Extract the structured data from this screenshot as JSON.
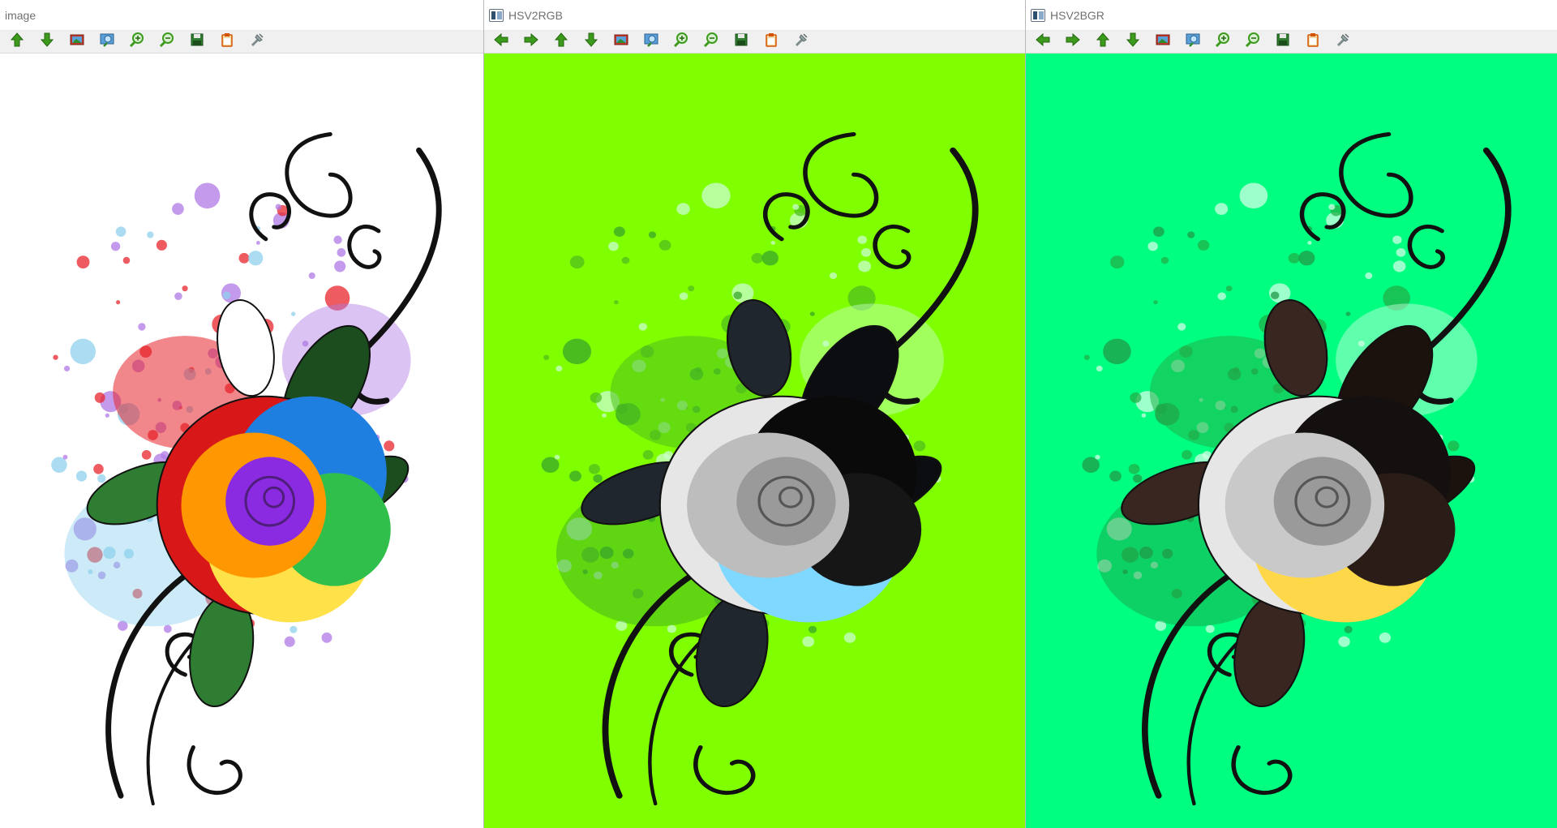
{
  "windows": [
    {
      "title": "image",
      "show_app_icon": false,
      "background": "#ffffff",
      "toolbar": [
        "arrow-up-icon",
        "arrow-down-icon",
        "image-icon",
        "zoom-region-icon",
        "zoom-in-icon",
        "zoom-out-icon",
        "save-icon",
        "copy-clipboard-icon",
        "properties-icon"
      ],
      "palette": {
        "splash1": "#e8242c",
        "splash2": "#b07ae6",
        "splash3": "#8fd0ee",
        "petal_outer": "#d81818",
        "petal2": "#ff9800",
        "petal3": "#ffe14a",
        "petal4": "#1e7fe0",
        "petal5": "#2fbf4a",
        "petal_center": "#8a2be2",
        "leaf": "#2e7d32",
        "leaf_dark": "#1b4d1f",
        "vine": "#111111"
      }
    },
    {
      "title": "HSV2RGB",
      "show_app_icon": true,
      "background": "#80ff00",
      "toolbar": [
        "arrow-left-icon",
        "arrow-right-icon",
        "arrow-up-icon",
        "arrow-down-icon",
        "image-icon",
        "zoom-region-icon",
        "zoom-in-icon",
        "zoom-out-icon",
        "save-icon",
        "copy-clipboard-icon",
        "properties-icon"
      ],
      "palette": {
        "splash1": "#4fbf1e",
        "splash2": "#c9ffd0",
        "splash3": "#3aa52a",
        "petal_outer": "#e6e6e6",
        "petal2": "#bdbdbd",
        "petal3": "#7fd8ff",
        "petal4": "#0a0a0a",
        "petal5": "#161616",
        "petal_center": "#9a9a9a",
        "leaf": "#20262e",
        "leaf_dark": "#0b0d10",
        "vine": "#111111"
      }
    },
    {
      "title": "HSV2BGR",
      "show_app_icon": true,
      "background": "#00ff80",
      "toolbar": [
        "arrow-left-icon",
        "arrow-right-icon",
        "arrow-up-icon",
        "arrow-down-icon",
        "image-icon",
        "zoom-region-icon",
        "zoom-in-icon",
        "zoom-out-icon",
        "save-icon",
        "copy-clipboard-icon",
        "properties-icon"
      ],
      "palette": {
        "splash1": "#21b04a",
        "splash2": "#d2ffe4",
        "splash3": "#1f9a45",
        "petal_outer": "#e6e6e6",
        "petal2": "#c9c9c9",
        "petal3": "#ffd84a",
        "petal4": "#141010",
        "petal5": "#2a1c16",
        "petal_center": "#9a9a9a",
        "leaf": "#3a2620",
        "leaf_dark": "#1b110d",
        "vine": "#111111"
      }
    }
  ]
}
